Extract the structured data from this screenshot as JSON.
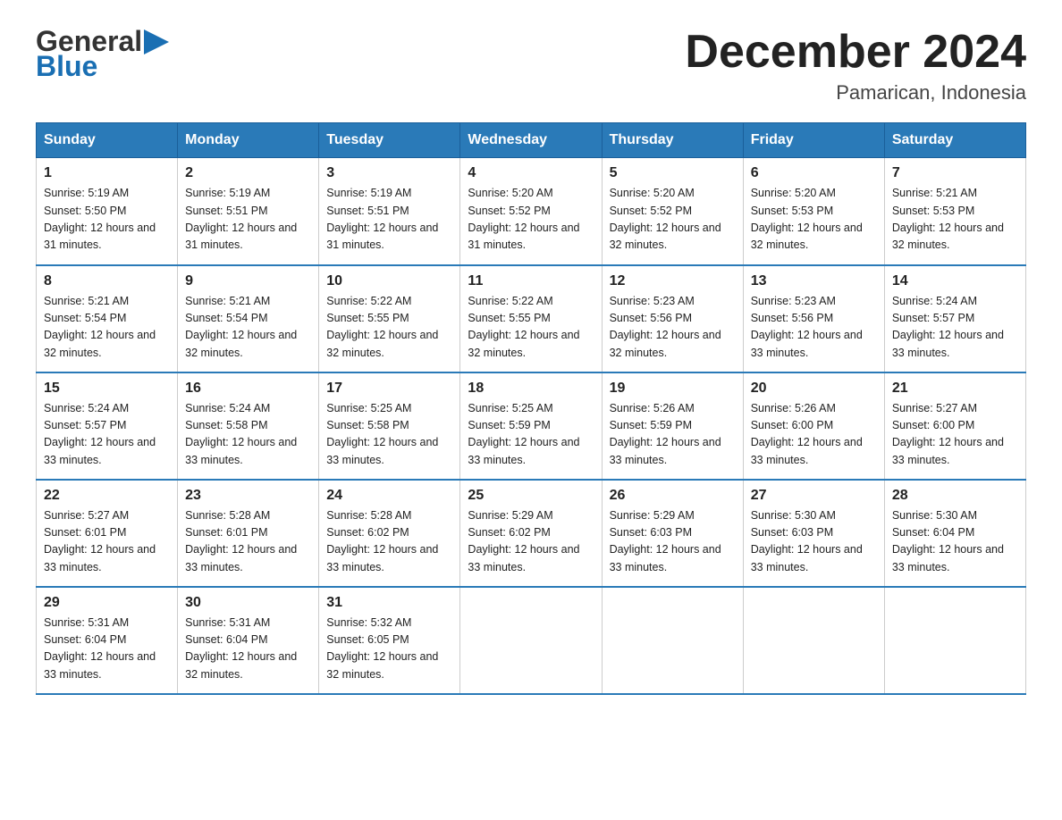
{
  "header": {
    "title": "December 2024",
    "subtitle": "Pamarican, Indonesia",
    "logo_line1": "General",
    "logo_line2": "Blue"
  },
  "days_of_week": [
    "Sunday",
    "Monday",
    "Tuesday",
    "Wednesday",
    "Thursday",
    "Friday",
    "Saturday"
  ],
  "weeks": [
    [
      {
        "day": "1",
        "sunrise": "5:19 AM",
        "sunset": "5:50 PM",
        "daylight": "12 hours and 31 minutes."
      },
      {
        "day": "2",
        "sunrise": "5:19 AM",
        "sunset": "5:51 PM",
        "daylight": "12 hours and 31 minutes."
      },
      {
        "day": "3",
        "sunrise": "5:19 AM",
        "sunset": "5:51 PM",
        "daylight": "12 hours and 31 minutes."
      },
      {
        "day": "4",
        "sunrise": "5:20 AM",
        "sunset": "5:52 PM",
        "daylight": "12 hours and 31 minutes."
      },
      {
        "day": "5",
        "sunrise": "5:20 AM",
        "sunset": "5:52 PM",
        "daylight": "12 hours and 32 minutes."
      },
      {
        "day": "6",
        "sunrise": "5:20 AM",
        "sunset": "5:53 PM",
        "daylight": "12 hours and 32 minutes."
      },
      {
        "day": "7",
        "sunrise": "5:21 AM",
        "sunset": "5:53 PM",
        "daylight": "12 hours and 32 minutes."
      }
    ],
    [
      {
        "day": "8",
        "sunrise": "5:21 AM",
        "sunset": "5:54 PM",
        "daylight": "12 hours and 32 minutes."
      },
      {
        "day": "9",
        "sunrise": "5:21 AM",
        "sunset": "5:54 PM",
        "daylight": "12 hours and 32 minutes."
      },
      {
        "day": "10",
        "sunrise": "5:22 AM",
        "sunset": "5:55 PM",
        "daylight": "12 hours and 32 minutes."
      },
      {
        "day": "11",
        "sunrise": "5:22 AM",
        "sunset": "5:55 PM",
        "daylight": "12 hours and 32 minutes."
      },
      {
        "day": "12",
        "sunrise": "5:23 AM",
        "sunset": "5:56 PM",
        "daylight": "12 hours and 32 minutes."
      },
      {
        "day": "13",
        "sunrise": "5:23 AM",
        "sunset": "5:56 PM",
        "daylight": "12 hours and 33 minutes."
      },
      {
        "day": "14",
        "sunrise": "5:24 AM",
        "sunset": "5:57 PM",
        "daylight": "12 hours and 33 minutes."
      }
    ],
    [
      {
        "day": "15",
        "sunrise": "5:24 AM",
        "sunset": "5:57 PM",
        "daylight": "12 hours and 33 minutes."
      },
      {
        "day": "16",
        "sunrise": "5:24 AM",
        "sunset": "5:58 PM",
        "daylight": "12 hours and 33 minutes."
      },
      {
        "day": "17",
        "sunrise": "5:25 AM",
        "sunset": "5:58 PM",
        "daylight": "12 hours and 33 minutes."
      },
      {
        "day": "18",
        "sunrise": "5:25 AM",
        "sunset": "5:59 PM",
        "daylight": "12 hours and 33 minutes."
      },
      {
        "day": "19",
        "sunrise": "5:26 AM",
        "sunset": "5:59 PM",
        "daylight": "12 hours and 33 minutes."
      },
      {
        "day": "20",
        "sunrise": "5:26 AM",
        "sunset": "6:00 PM",
        "daylight": "12 hours and 33 minutes."
      },
      {
        "day": "21",
        "sunrise": "5:27 AM",
        "sunset": "6:00 PM",
        "daylight": "12 hours and 33 minutes."
      }
    ],
    [
      {
        "day": "22",
        "sunrise": "5:27 AM",
        "sunset": "6:01 PM",
        "daylight": "12 hours and 33 minutes."
      },
      {
        "day": "23",
        "sunrise": "5:28 AM",
        "sunset": "6:01 PM",
        "daylight": "12 hours and 33 minutes."
      },
      {
        "day": "24",
        "sunrise": "5:28 AM",
        "sunset": "6:02 PM",
        "daylight": "12 hours and 33 minutes."
      },
      {
        "day": "25",
        "sunrise": "5:29 AM",
        "sunset": "6:02 PM",
        "daylight": "12 hours and 33 minutes."
      },
      {
        "day": "26",
        "sunrise": "5:29 AM",
        "sunset": "6:03 PM",
        "daylight": "12 hours and 33 minutes."
      },
      {
        "day": "27",
        "sunrise": "5:30 AM",
        "sunset": "6:03 PM",
        "daylight": "12 hours and 33 minutes."
      },
      {
        "day": "28",
        "sunrise": "5:30 AM",
        "sunset": "6:04 PM",
        "daylight": "12 hours and 33 minutes."
      }
    ],
    [
      {
        "day": "29",
        "sunrise": "5:31 AM",
        "sunset": "6:04 PM",
        "daylight": "12 hours and 33 minutes."
      },
      {
        "day": "30",
        "sunrise": "5:31 AM",
        "sunset": "6:04 PM",
        "daylight": "12 hours and 32 minutes."
      },
      {
        "day": "31",
        "sunrise": "5:32 AM",
        "sunset": "6:05 PM",
        "daylight": "12 hours and 32 minutes."
      },
      null,
      null,
      null,
      null
    ]
  ]
}
